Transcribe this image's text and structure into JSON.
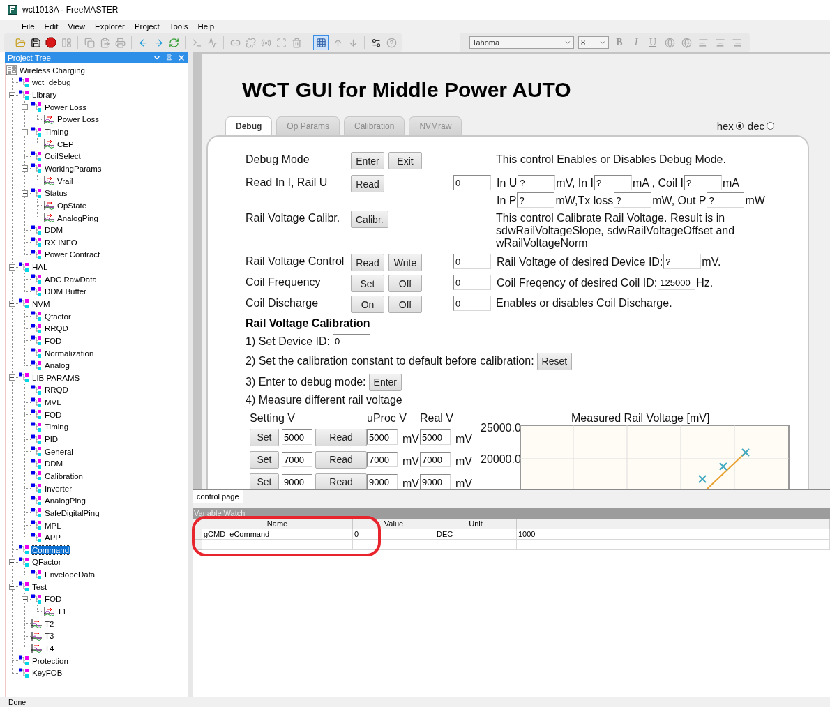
{
  "window": {
    "title": "wct1013A - FreeMASTER"
  },
  "menu": [
    "File",
    "Edit",
    "View",
    "Explorer",
    "Project",
    "Tools",
    "Help"
  ],
  "font_toolbar": {
    "font": "Tahoma",
    "size": "8",
    "format_buttons": [
      "B",
      "I",
      "U"
    ]
  },
  "project_tree": {
    "title": "Project Tree",
    "root": {
      "label": "Wireless Charging",
      "kind": "root",
      "selected": false,
      "children": [
        {
          "label": "wct_debug",
          "kind": "group",
          "selected": false
        },
        {
          "label": "Library",
          "kind": "group",
          "selected": false,
          "expanded": true,
          "children": [
            {
              "label": "Power Loss",
              "kind": "group",
              "selected": false,
              "expanded": true,
              "children": [
                {
                  "label": "Power Loss",
                  "kind": "scope",
                  "selected": false
                }
              ]
            },
            {
              "label": "Timing",
              "kind": "group",
              "selected": false,
              "expanded": true,
              "children": [
                {
                  "label": "CEP",
                  "kind": "scope",
                  "selected": false
                }
              ]
            },
            {
              "label": "CoilSelect",
              "kind": "group",
              "selected": false
            },
            {
              "label": "WorkingParams",
              "kind": "group",
              "selected": false,
              "expanded": true,
              "children": [
                {
                  "label": "Vrail",
                  "kind": "scope",
                  "selected": false
                }
              ]
            },
            {
              "label": "Status",
              "kind": "group",
              "selected": false,
              "expanded": true,
              "children": [
                {
                  "label": "OpState",
                  "kind": "scope",
                  "selected": false
                },
                {
                  "label": "AnalogPing",
                  "kind": "scope",
                  "selected": false
                }
              ]
            },
            {
              "label": "DDM",
              "kind": "group",
              "selected": false
            },
            {
              "label": "RX INFO",
              "kind": "group",
              "selected": false
            },
            {
              "label": "Power Contract",
              "kind": "group",
              "selected": false
            }
          ]
        },
        {
          "label": "HAL",
          "kind": "group",
          "selected": false,
          "expanded": true,
          "children": [
            {
              "label": "ADC RawData",
              "kind": "group",
              "selected": false
            },
            {
              "label": "DDM Buffer",
              "kind": "group",
              "selected": false
            }
          ]
        },
        {
          "label": "NVM",
          "kind": "group",
          "selected": false,
          "expanded": true,
          "children": [
            {
              "label": "Qfactor",
              "kind": "group",
              "selected": false
            },
            {
              "label": "RRQD",
              "kind": "group",
              "selected": false
            },
            {
              "label": "FOD",
              "kind": "group",
              "selected": false
            },
            {
              "label": "Normalization",
              "kind": "group",
              "selected": false
            },
            {
              "label": "Analog",
              "kind": "group",
              "selected": false
            }
          ]
        },
        {
          "label": "LIB PARAMS",
          "kind": "group",
          "selected": false,
          "expanded": true,
          "children": [
            {
              "label": "RRQD",
              "kind": "group",
              "selected": false
            },
            {
              "label": "MVL",
              "kind": "group",
              "selected": false
            },
            {
              "label": "FOD",
              "kind": "group",
              "selected": false
            },
            {
              "label": "Timing",
              "kind": "group",
              "selected": false
            },
            {
              "label": "PID",
              "kind": "group",
              "selected": false
            },
            {
              "label": "General",
              "kind": "group",
              "selected": false
            },
            {
              "label": "DDM",
              "kind": "group",
              "selected": false
            },
            {
              "label": "Calibration",
              "kind": "group",
              "selected": false
            },
            {
              "label": "Inverter",
              "kind": "group",
              "selected": false
            },
            {
              "label": "AnalogPing",
              "kind": "group",
              "selected": false
            },
            {
              "label": "SafeDigitalPing",
              "kind": "group",
              "selected": false
            },
            {
              "label": "MPL",
              "kind": "group",
              "selected": false
            },
            {
              "label": "APP",
              "kind": "group",
              "selected": false
            }
          ]
        },
        {
          "label": "Command",
          "kind": "group",
          "selected": true
        },
        {
          "label": "QFactor",
          "kind": "group",
          "selected": false,
          "expanded": true,
          "children": [
            {
              "label": "EnvelopeData",
              "kind": "group",
              "selected": false
            }
          ]
        },
        {
          "label": "Test",
          "kind": "group",
          "selected": false,
          "expanded": true,
          "children": [
            {
              "label": "FOD",
              "kind": "group",
              "selected": false,
              "expanded": true,
              "children": [
                {
                  "label": "T1",
                  "kind": "scope",
                  "selected": false
                }
              ]
            },
            {
              "label": "T2",
              "kind": "scope",
              "selected": false
            },
            {
              "label": "T3",
              "kind": "scope",
              "selected": false
            },
            {
              "label": "T4",
              "kind": "scope",
              "selected": false
            }
          ]
        },
        {
          "label": "Protection",
          "kind": "group",
          "selected": false
        },
        {
          "label": "KeyFOB",
          "kind": "group",
          "selected": false
        }
      ]
    }
  },
  "control_page": {
    "title": "WCT GUI for Middle Power AUTO",
    "tabs": [
      {
        "label": "Debug",
        "selected": true
      },
      {
        "label": "Op Params",
        "selected": false
      },
      {
        "label": "Calibration",
        "selected": false
      },
      {
        "label": "NVMraw",
        "selected": false
      }
    ],
    "format_options": [
      {
        "label": "hex",
        "selected": true
      },
      {
        "label": "dec",
        "selected": false
      }
    ],
    "controls": [
      {
        "kind": "info",
        "label": "Debug Mode",
        "buttons": [
          "Enter",
          "Exit"
        ],
        "description": "This control Enables or Disables Debug Mode."
      },
      {
        "kind": "readout",
        "label": "Read In I, Rail U",
        "buttons": [
          "Read"
        ],
        "value": "0",
        "lines": [
          [
            {
              "kind": "text",
              "text": "In U"
            },
            {
              "kind": "field",
              "value": "?"
            },
            {
              "kind": "text",
              "text": "mV, In I"
            },
            {
              "kind": "field",
              "value": "?"
            },
            {
              "kind": "text",
              "text": "mA , Coil I"
            },
            {
              "kind": "field",
              "value": "?"
            },
            {
              "kind": "text",
              "text": "mA"
            }
          ],
          [
            {
              "kind": "text",
              "text": "In P"
            },
            {
              "kind": "field",
              "value": "?"
            },
            {
              "kind": "text",
              "text": "mW,Tx loss"
            },
            {
              "kind": "field",
              "value": "?"
            },
            {
              "kind": "text",
              "text": "mW, Out P"
            },
            {
              "kind": "field",
              "value": "?"
            },
            {
              "kind": "text",
              "text": "mW"
            }
          ]
        ]
      },
      {
        "kind": "info",
        "label": "Rail Voltage Calibr.",
        "buttons": [
          "Calibr."
        ],
        "description": "This control Calibrate Rail Voltage. Result is in sdwRailVoltageSlope, sdwRailVoltageOffset and wRailVoltageNorm"
      },
      {
        "kind": "readout",
        "label": "Rail Voltage Control",
        "buttons": [
          "Read",
          "Write"
        ],
        "value": "0",
        "lines": [
          [
            {
              "kind": "text",
              "text": "Rail Voltage of desired Device ID:"
            },
            {
              "kind": "field",
              "value": "?"
            },
            {
              "kind": "text",
              "text": "mV."
            }
          ]
        ]
      },
      {
        "kind": "readout",
        "label": "Coil Frequency",
        "buttons": [
          "Set",
          "Off"
        ],
        "value": "0",
        "lines": [
          [
            {
              "kind": "text",
              "text": "Coil Freqency of desired Coil ID:"
            },
            {
              "kind": "field",
              "value": "125000"
            },
            {
              "kind": "text",
              "text": "Hz."
            }
          ]
        ]
      },
      {
        "kind": "info",
        "label": "Coil Discharge",
        "buttons": [
          "On",
          "Off"
        ],
        "value": "0",
        "description": "Enables or disables Coil Discharge."
      }
    ],
    "calibration": {
      "title": "Rail Voltage Calibration",
      "steps": [
        {
          "kind": "field",
          "text": "1) Set Device ID:",
          "value": "0"
        },
        {
          "kind": "button",
          "text": "2) Set the calibration constant to default before calibration:",
          "button": "Reset"
        },
        {
          "kind": "button",
          "text": "3) Enter to debug mode:",
          "button": "Enter"
        },
        {
          "kind": "text",
          "text": "4) Measure different rail voltage"
        }
      ]
    },
    "measure_table": {
      "headers": [
        "Setting V",
        "uProc V",
        "Real V"
      ],
      "rows": [
        {
          "set": "Set",
          "setting": "5000",
          "read": "Read",
          "uproc": "5000",
          "uproc_unit": "mV",
          "real": "5000",
          "real_unit": "mV"
        },
        {
          "set": "Set",
          "setting": "7000",
          "read": "Read",
          "uproc": "7000",
          "uproc_unit": "mV",
          "real": "7000",
          "real_unit": "mV"
        },
        {
          "set": "Set",
          "setting": "9000",
          "read": "Read",
          "uproc": "9000",
          "uproc_unit": "mV",
          "real": "9000",
          "real_unit": "mV"
        }
      ]
    },
    "chart": {
      "title": "Measured Rail Voltage [mV]",
      "y_tick_labels": [
        "25000.0",
        "20000.0"
      ]
    }
  },
  "page_tabs": [
    {
      "label": "control page",
      "selected": true
    }
  ],
  "variable_watch": {
    "title": "Variable Watch",
    "columns": [
      "Name",
      "Value",
      "Unit"
    ],
    "rows": [
      [
        "gCMD_eCommand",
        "0",
        "DEC",
        "1000"
      ]
    ]
  },
  "status_bar": "Done"
}
